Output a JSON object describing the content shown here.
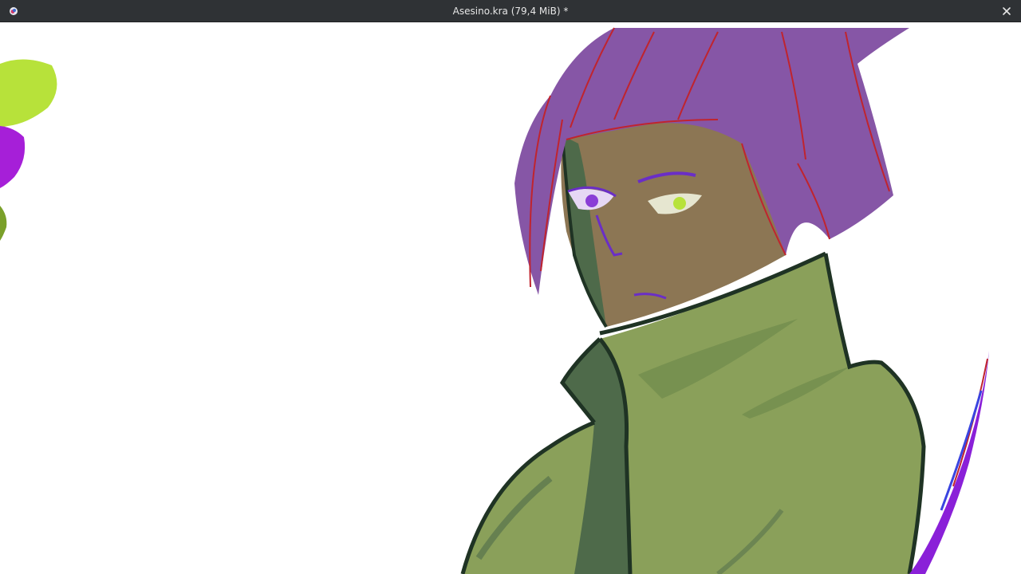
{
  "window": {
    "title": "Asesino.kra (79,4 MiB) *",
    "app_icon": "krita-icon",
    "close_icon": "close-icon"
  },
  "canvas": {
    "content": "digital painting",
    "colors": {
      "hair": "#8656a6",
      "hair_line": "#c0242e",
      "skin": "#8c7654",
      "coat": "#8aa05a",
      "coat_shadow": "#4e6a4a",
      "outline": "#1f3324",
      "eye_accent": "#7b3ed6",
      "swatch_lime": "#b7e23a",
      "swatch_magenta": "#a61fd8",
      "blade": "#8a20d8"
    }
  }
}
